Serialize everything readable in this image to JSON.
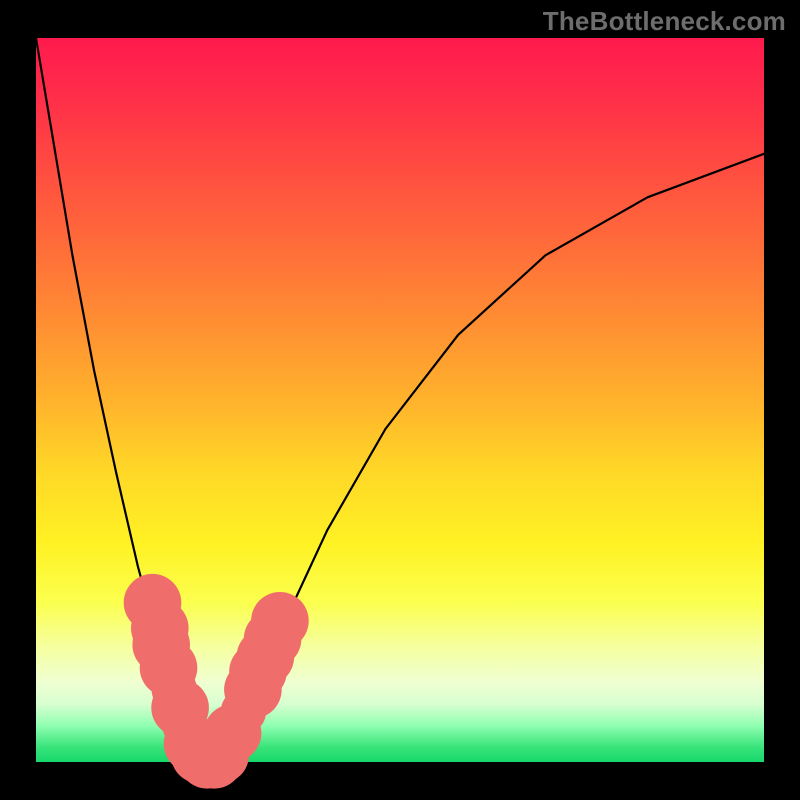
{
  "watermark": "TheBottleneck.com",
  "chart_data": {
    "type": "line",
    "title": "",
    "xlabel": "",
    "ylabel": "",
    "xlim": [
      0,
      100
    ],
    "ylim": [
      0,
      100
    ],
    "grid": false,
    "legend": false,
    "series": [
      {
        "name": "bottleneck-curve",
        "x": [
          0,
          2,
          5,
          8,
          11,
          14,
          17,
          19,
          20.5,
          22,
          23.5,
          25,
          27,
          30,
          34,
          40,
          48,
          58,
          70,
          84,
          100
        ],
        "values": [
          100,
          88,
          70,
          54,
          40,
          27,
          16,
          8,
          4,
          1,
          0,
          1,
          4,
          10,
          19,
          32,
          46,
          59,
          70,
          78,
          84
        ]
      }
    ],
    "markers": {
      "name": "highlight-dots",
      "color": "#ef6d6a",
      "points": [
        {
          "x": 16.0,
          "y": 22.0,
          "r": 3.3
        },
        {
          "x": 17.0,
          "y": 18.5,
          "r": 3.3
        },
        {
          "x": 17.2,
          "y": 16.2,
          "r": 3.3
        },
        {
          "x": 18.2,
          "y": 13.0,
          "r": 3.3
        },
        {
          "x": 19.0,
          "y": 10.0,
          "r": 2.6
        },
        {
          "x": 19.8,
          "y": 7.5,
          "r": 3.3
        },
        {
          "x": 20.5,
          "y": 5.0,
          "r": 2.6
        },
        {
          "x": 21.5,
          "y": 2.5,
          "r": 3.3
        },
        {
          "x": 22.5,
          "y": 1.0,
          "r": 3.3
        },
        {
          "x": 23.5,
          "y": 0.3,
          "r": 3.3
        },
        {
          "x": 24.5,
          "y": 0.3,
          "r": 3.3
        },
        {
          "x": 25.3,
          "y": 1.0,
          "r": 3.3
        },
        {
          "x": 26.0,
          "y": 2.0,
          "r": 2.6
        },
        {
          "x": 27.0,
          "y": 4.0,
          "r": 3.3
        },
        {
          "x": 28.5,
          "y": 7.0,
          "r": 2.6
        },
        {
          "x": 29.8,
          "y": 10.0,
          "r": 3.3
        },
        {
          "x": 30.5,
          "y": 12.5,
          "r": 3.3
        },
        {
          "x": 31.5,
          "y": 14.5,
          "r": 3.3
        },
        {
          "x": 32.5,
          "y": 17.0,
          "r": 3.3
        },
        {
          "x": 33.5,
          "y": 19.5,
          "r": 3.3
        }
      ]
    }
  }
}
